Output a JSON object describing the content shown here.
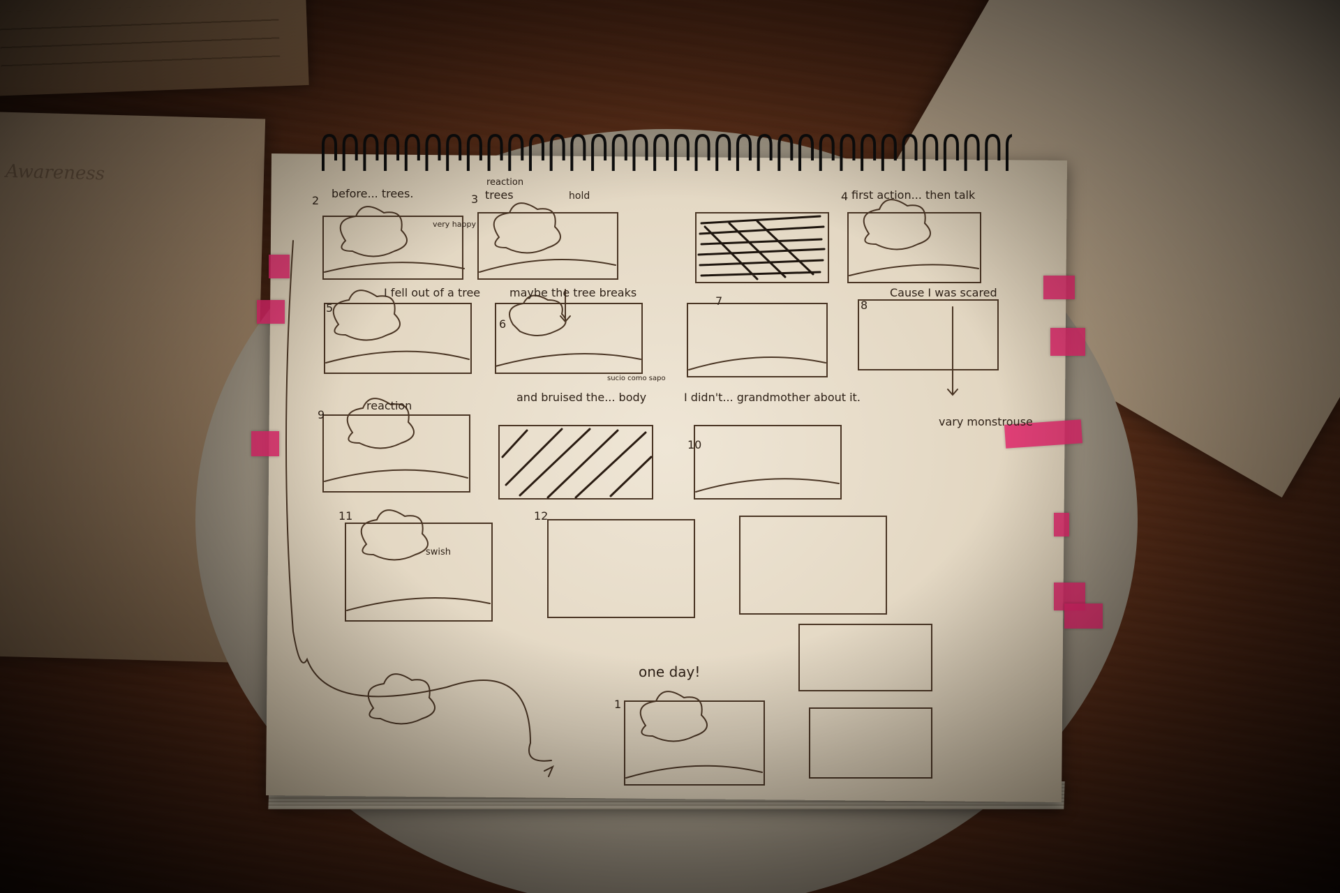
{
  "photo": {
    "subject": "storyboard-sketchbook",
    "colors": {
      "table": "#5e3019",
      "paper": "#efe6d6",
      "pencil": "#2e2117",
      "sticky_flags": "#e0266a"
    }
  },
  "storyboard": {
    "p1": {
      "number": "2",
      "caption": "before... trees.",
      "note": "very happy"
    },
    "p2": {
      "number": "3",
      "caption": "trees",
      "tag": "reaction",
      "hold": "hold"
    },
    "p3": {
      "number": ""
    },
    "p4": {
      "number": "4",
      "caption": "first action... then talk"
    },
    "p5": {
      "number": "5",
      "caption": "I fell out of a tree"
    },
    "p6": {
      "number": "6",
      "caption": "maybe the tree breaks",
      "bubble": "sucio como sapo"
    },
    "p7": {
      "number": "7"
    },
    "p8": {
      "number": "8",
      "caption": "Cause I was scared",
      "side": "vary monstrouse"
    },
    "p9": {
      "number": "9",
      "caption": "reaction"
    },
    "p10": {
      "number": "",
      "caption": "and bruised the... body"
    },
    "p11": {
      "number": "10",
      "caption": "I didn't... grandmother about it."
    },
    "p12": {
      "number": "11",
      "sound": "swish"
    },
    "p13": {
      "number": "12"
    },
    "p14": {
      "number": ""
    },
    "p15": {
      "number": "1",
      "caption": "one day!"
    }
  },
  "left_paper": {
    "title": "Awareness"
  }
}
